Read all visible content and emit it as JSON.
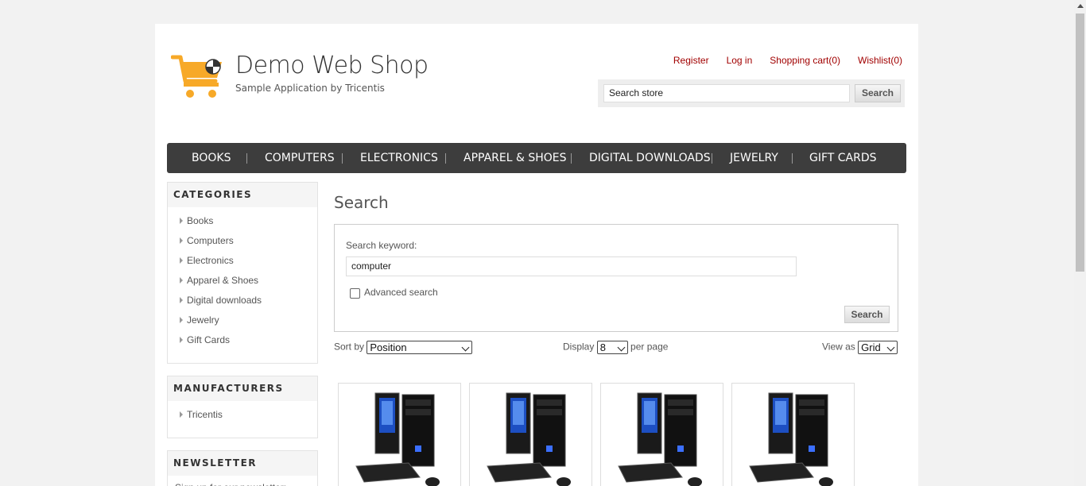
{
  "header": {
    "title": "Demo Web Shop",
    "subtitle": "Sample Application by Tricentis",
    "links": [
      "Register",
      "Log in",
      "Shopping cart(0)",
      "Wishlist(0)"
    ],
    "search_value": "Search store",
    "search_button": "Search"
  },
  "nav": [
    "BOOKS",
    "COMPUTERS",
    "ELECTRONICS",
    "APPAREL & SHOES",
    "DIGITAL DOWNLOADS",
    "JEWELRY",
    "GIFT CARDS"
  ],
  "sidebar": {
    "categories_title": "CATEGORIES",
    "categories": [
      "Books",
      "Computers",
      "Electronics",
      "Apparel & Shoes",
      "Digital downloads",
      "Jewelry",
      "Gift Cards"
    ],
    "manufacturers_title": "MANUFACTURERS",
    "manufacturers": [
      "Tricentis"
    ],
    "newsletter_title": "NEWSLETTER",
    "newsletter_text": "Sign up for our newsletter:"
  },
  "main": {
    "title": "Search",
    "keyword_label": "Search keyword:",
    "keyword_value": "computer",
    "advanced_label": "Advanced search",
    "search_button": "Search",
    "sort_label": "Sort by",
    "sort_value": "Position",
    "display_label": "Display",
    "display_value": "8",
    "per_page": "per page",
    "view_label": "View as",
    "view_value": "Grid",
    "products": [
      "computer-product-1",
      "computer-product-2",
      "computer-product-3",
      "computer-product-4"
    ]
  },
  "colors": {
    "accent": "#a10000",
    "nav_bg": "#3d3d3d",
    "logo": "#f7a928"
  }
}
